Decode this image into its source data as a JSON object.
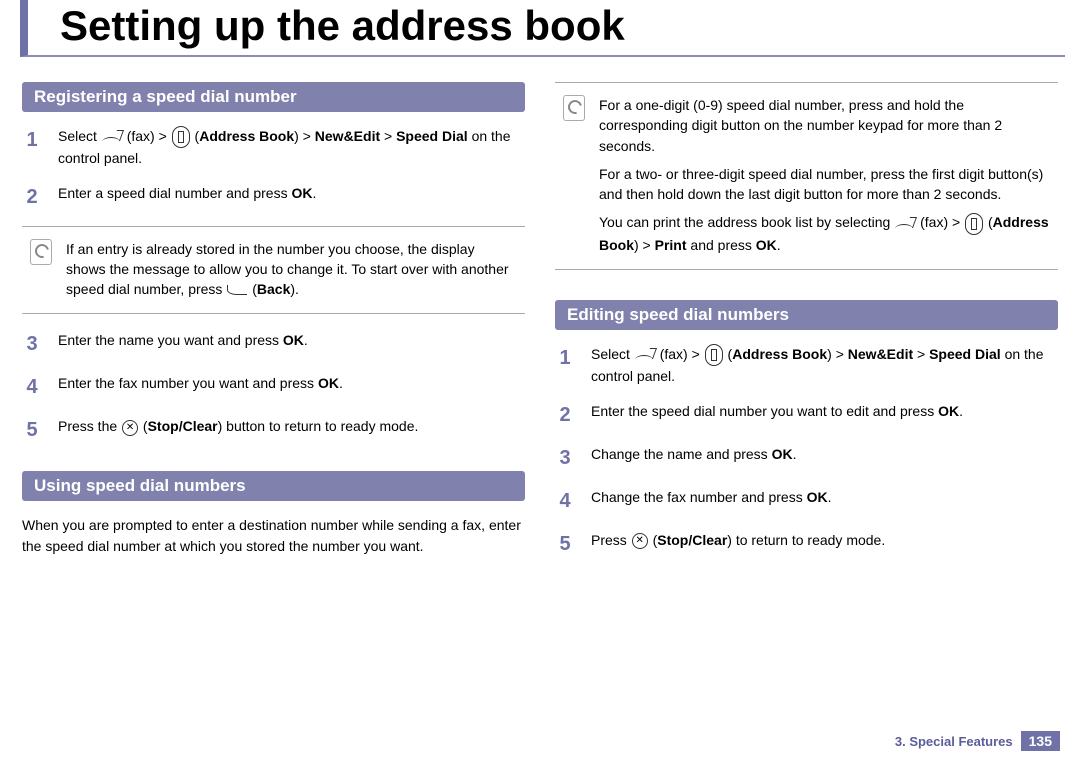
{
  "page_title": "Setting up the address book",
  "left": {
    "sectionA": {
      "header": "Registering a speed dial number",
      "steps": [
        {
          "n": "1",
          "text": "Select {fax} (fax) > {book} (<b>Address Book</b>) > <b>New&Edit</b> > <b>Speed Dial</b> on the control panel."
        },
        {
          "n": "2",
          "text": "Enter a speed dial number and press <b>OK</b>."
        }
      ],
      "note": "If an entry is already stored in the number you choose, the display shows the message to allow you to change it. To start over with another speed dial number, press {back} (<b>Back</b>).",
      "steps2": [
        {
          "n": "3",
          "text": "Enter the name you want and press <b>OK</b>."
        },
        {
          "n": "4",
          "text": "Enter the fax number you want and press <b>OK</b>."
        },
        {
          "n": "5",
          "text": "Press the {cx} (<b>Stop/Clear</b>) button to return to ready mode."
        }
      ]
    },
    "sectionB": {
      "header": "Using speed dial numbers",
      "intro": "When you are prompted to enter a destination number while sending a fax, enter the speed dial number at which you stored the number you want."
    }
  },
  "right": {
    "note": {
      "p1": "For a one-digit (0-9) speed dial number, press and hold the corresponding digit button on the number keypad for more than 2 seconds.",
      "p2": "For a two- or three-digit speed dial number, press the first digit button(s) and then hold down the last digit button for more than 2 seconds.",
      "p3": "You can print the address book list by selecting {fax} (fax) > {book} (<b>Address Book</b>) > <b>Print</b> and press <b>OK</b>."
    },
    "sectionC": {
      "header": "Editing speed dial numbers",
      "steps": [
        {
          "n": "1",
          "text": "Select {fax} (fax) > {book} (<b>Address Book</b>) > <b>New&Edit</b> > <b>Speed Dial</b> on the control panel."
        },
        {
          "n": "2",
          "text": "Enter the speed dial number you want to edit and press <b>OK</b>."
        },
        {
          "n": "3",
          "text": "Change the name and press <b>OK</b>."
        },
        {
          "n": "4",
          "text": "Change the fax number and press <b>OK</b>."
        },
        {
          "n": "5",
          "text": "Press {cx} (<b>Stop/Clear</b>) to return to ready mode."
        }
      ]
    }
  },
  "footer": {
    "chapter": "3.  Special Features",
    "page": "135"
  }
}
